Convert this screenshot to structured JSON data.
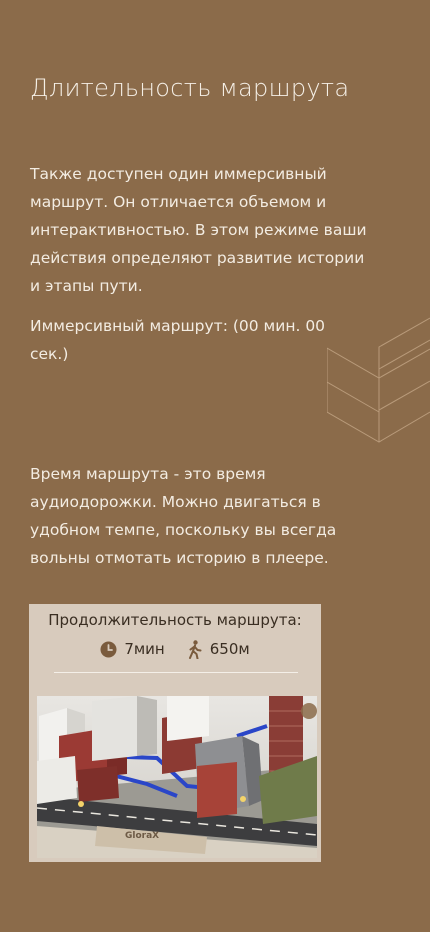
{
  "section": {
    "title": "Длительность маршрута",
    "intro": "Также доступен один иммерсивный маршрут. Он отличается объемом и интерактивностью. В этом режиме ваши действия определяют развитие истории и этапы пути.",
    "immersive_label": "Иммерсивный маршрут: (00 мин. 00 сек.)",
    "time_note": "Время маршрута - это время аудиодорожки. Можно двигаться в удобном темпе, поскольку вы всегда вольны отмотать историю в плеере."
  },
  "route_card": {
    "title": "Продолжительность маршрута:",
    "duration": "7мин",
    "distance": "650м",
    "duration_icon": "clock-icon",
    "distance_icon": "walking-person-icon",
    "image_label": "city-model-image"
  },
  "colors": {
    "background": "#8b6b4a",
    "card_background": "#d8cbbd",
    "text_light": "#f3ece2",
    "text_dark": "#3a2e22"
  }
}
